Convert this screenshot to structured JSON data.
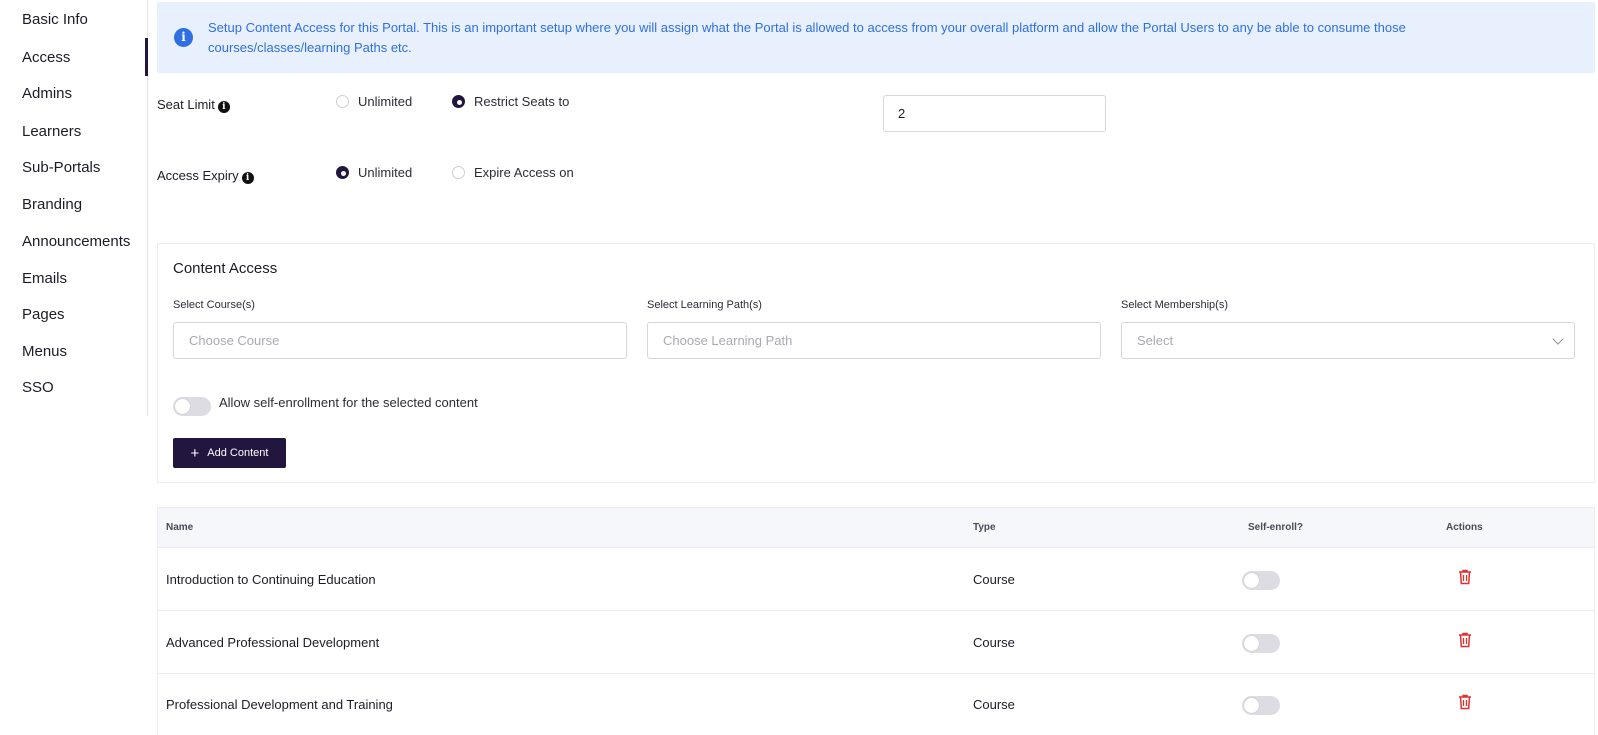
{
  "sidebar": {
    "items": [
      {
        "label": "Basic Info"
      },
      {
        "label": "Access"
      },
      {
        "label": "Admins"
      },
      {
        "label": "Learners"
      },
      {
        "label": "Sub-Portals"
      },
      {
        "label": "Branding"
      },
      {
        "label": "Announcements"
      },
      {
        "label": "Emails"
      },
      {
        "label": "Pages"
      },
      {
        "label": "Menus"
      },
      {
        "label": "SSO"
      }
    ],
    "active": "Access"
  },
  "banner": {
    "icon": "info-icon",
    "text": "Setup Content Access for this Portal. This is an important setup where you will assign what the Portal is allowed to access from your overall platform and allow the Portal Users to any be able to consume those courses/classes/learning Paths etc."
  },
  "seat_limit": {
    "label": "Seat Limit",
    "options": [
      "Unlimited",
      "Restrict Seats to"
    ],
    "selected": "Restrict Seats to",
    "value": "2"
  },
  "access_expiry": {
    "label": "Access Expiry",
    "options": [
      "Unlimited",
      "Expire Access on"
    ],
    "selected": "Unlimited"
  },
  "content_access": {
    "title": "Content Access",
    "course": {
      "label": "Select Course(s)",
      "placeholder": "Choose Course"
    },
    "learning_path": {
      "label": "Select Learning Path(s)",
      "placeholder": "Choose Learning Path"
    },
    "membership": {
      "label": "Select Membership(s)",
      "placeholder": "Select"
    },
    "self_enroll_label": "Allow self-enrollment for the selected content",
    "self_enroll_on": false,
    "add_button": "Add Content"
  },
  "table": {
    "headers": {
      "name": "Name",
      "type": "Type",
      "self_enroll": "Self-enroll?",
      "actions": "Actions"
    },
    "rows": [
      {
        "name": "Introduction to Continuing Education",
        "type": "Course",
        "self_enroll": false
      },
      {
        "name": "Advanced Professional Development",
        "type": "Course",
        "self_enroll": false
      },
      {
        "name": "Professional Development and Training",
        "type": "Course",
        "self_enroll": false
      }
    ]
  },
  "colors": {
    "accent": "#22163f",
    "info_bg": "#e8f0fd",
    "info_text": "#2f6fe4",
    "danger": "#e03131"
  }
}
